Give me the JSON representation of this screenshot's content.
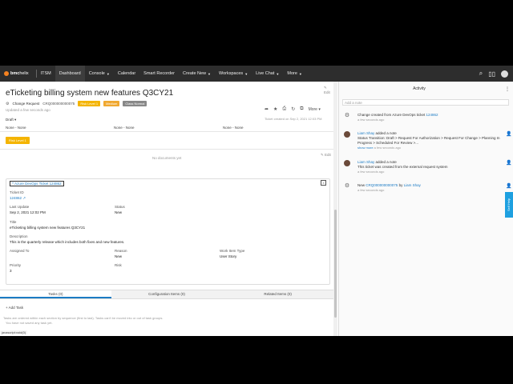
{
  "nav": {
    "brand": "bmc",
    "brand_sub": "helix",
    "product": "ITSM",
    "items": [
      "Dashboard",
      "Console",
      "Calendar",
      "Smart Recorder",
      "Create New",
      "Workspaces",
      "Live Chat",
      "More"
    ]
  },
  "ticket": {
    "title": "eTicketing billing system new features Q3CY21",
    "edit_label": "Edit",
    "type_label": "Change Request",
    "id": "CRQ000000000075",
    "badges": [
      "Risk Level 1",
      "Medium",
      "Class Normal"
    ],
    "updated": "Updated a few seconds ago",
    "more_label": "More",
    "status": "Draft",
    "created": "Ticket created on Sep 2, 2021 12:03 PM",
    "none_cells": [
      "None - None",
      "None - None",
      "None - None"
    ],
    "risk_button": "Risk Level 1",
    "no_documents": "No documents yet"
  },
  "azure": {
    "header_link": "Azure DevOps Ticket 124862",
    "ticket_id_label": "Ticket ID",
    "ticket_id": "124862",
    "last_update_label": "Last Update",
    "last_update": "Sep 2, 2021 12:02 PM",
    "status_label": "Status",
    "status": "New",
    "title_label": "Title",
    "title": "eTicketing billing system new features Q3CY21",
    "description_label": "Description",
    "description": "This is the quarterly release which includes both fixes and new features.",
    "assigned_to_label": "Assigned To",
    "reason_label": "Reason",
    "reason": "New",
    "work_item_type_label": "Work Item Type",
    "work_item_type": "User Story",
    "priority_label": "Priority",
    "priority": "3",
    "risk_label": "Risk"
  },
  "tabs": [
    "Tasks (0)",
    "Configuration Items (0)",
    "Related Items (0)"
  ],
  "tasks": {
    "add_label": "Add Task",
    "info_line1": "Tasks are ordered within each section by sequence (first to last). Tasks can't be moved into or out of task groups.",
    "info_line2": "You have not saved any task yet.",
    "status_strip": "javascript:void(0)"
  },
  "activity": {
    "title": "Activity",
    "note_placeholder": "Add a note",
    "items": [
      {
        "text": "Change created from Azure DevOps ticket ",
        "link": "124862",
        "time": "a few seconds ago"
      },
      {
        "author": "Liam Shay",
        "action": " added a note",
        "text": "Status Transition: Draft > Request For Authorization > Request For Change > Planning In Progress > Scheduled For Review >...",
        "more": "show more",
        "time": " a few seconds ago"
      },
      {
        "author": "Liam Shay",
        "action": " added a note",
        "text": "This ticket was created from the external request system",
        "time": "a few seconds ago"
      },
      {
        "text": "New ",
        "link": "CRQ000000000075",
        "by": " by ",
        "author": "Liam Shay",
        "time": "a few seconds ago"
      }
    ],
    "side_tab": "Self Help"
  },
  "colors": {
    "nav_bg": "#2d2d2d",
    "accent": "#1b7bc4",
    "risk": "#f4b400",
    "logo": "#f58220"
  }
}
